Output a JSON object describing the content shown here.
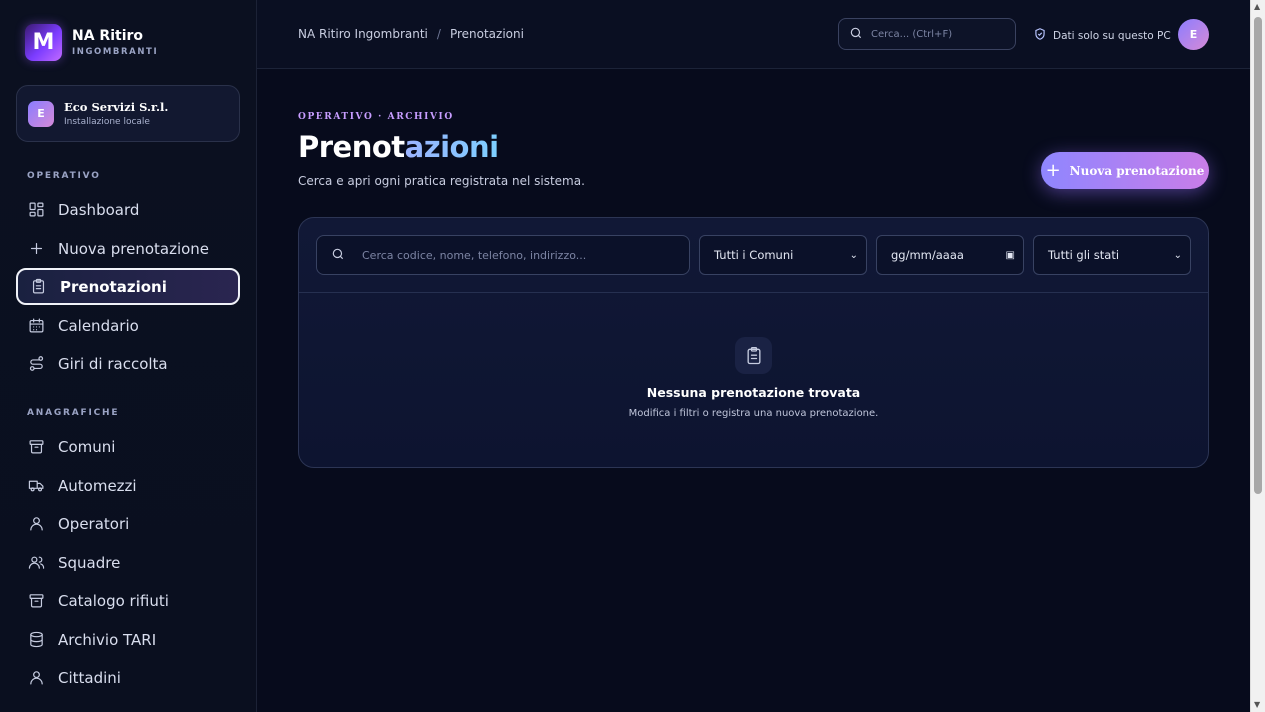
{
  "brand": {
    "name": "NA Ritiro",
    "sub": "INGOMBRANTI",
    "logo_letter": "M"
  },
  "org": {
    "initial": "E",
    "name": "Eco Servizi S.r.l.",
    "sub": "Installazione locale"
  },
  "sidebar": {
    "section_operativo": "OPERATIVO",
    "section_anagrafiche": "ANAGRAFICHE",
    "items": [
      {
        "label": "Dashboard",
        "icon": "dashboard-icon",
        "active": false
      },
      {
        "label": "Nuova prenotazione",
        "icon": "plus-icon",
        "active": false
      },
      {
        "label": "Prenotazioni",
        "icon": "clipboard-icon",
        "active": true
      },
      {
        "label": "Calendario",
        "icon": "calendar-icon",
        "active": false
      },
      {
        "label": "Giri di raccolta",
        "icon": "route-icon",
        "active": false
      },
      {
        "label": "Comuni",
        "icon": "archive-icon",
        "active": false
      },
      {
        "label": "Automezzi",
        "icon": "truck-icon",
        "active": false
      },
      {
        "label": "Operatori",
        "icon": "user-icon",
        "active": false
      },
      {
        "label": "Squadre",
        "icon": "users-icon",
        "active": false
      },
      {
        "label": "Catalogo rifiuti",
        "icon": "archive-icon",
        "active": false
      },
      {
        "label": "Archivio TARI",
        "icon": "database-icon",
        "active": false
      },
      {
        "label": "Cittadini",
        "icon": "user-icon",
        "active": false
      }
    ]
  },
  "topbar": {
    "breadcrumb": [
      "NA Ritiro Ingombranti",
      "Prenotazioni"
    ],
    "breadcrumb_sep": "/",
    "search_placeholder": "Cerca... (Ctrl+F)",
    "local_note": "Dati solo su questo PC",
    "user_initial": "E"
  },
  "main": {
    "eyebrow": "OPERATIVO · ARCHIVIO",
    "title_part1": "Prenot",
    "title_part2": "azioni",
    "subtitle": "Cerca e apri ogni pratica registrata nel sistema.",
    "new_button": "Nuova prenotazione",
    "new_button_plus": "+"
  },
  "filters": {
    "search_placeholder": "Cerca codice, nome, telefono, indirizzo...",
    "comuni": "Tutti i Comuni",
    "date": "gg/mm/aaaa",
    "stati": "Tutti gli stati"
  },
  "empty": {
    "title": "Nessuna prenotazione trovata",
    "sub": "Modifica i filtri o registra una nuova prenotazione."
  },
  "colors": {
    "accent_start": "#8f86ff",
    "accent_end": "#c97de8",
    "background": "#070b1c"
  }
}
